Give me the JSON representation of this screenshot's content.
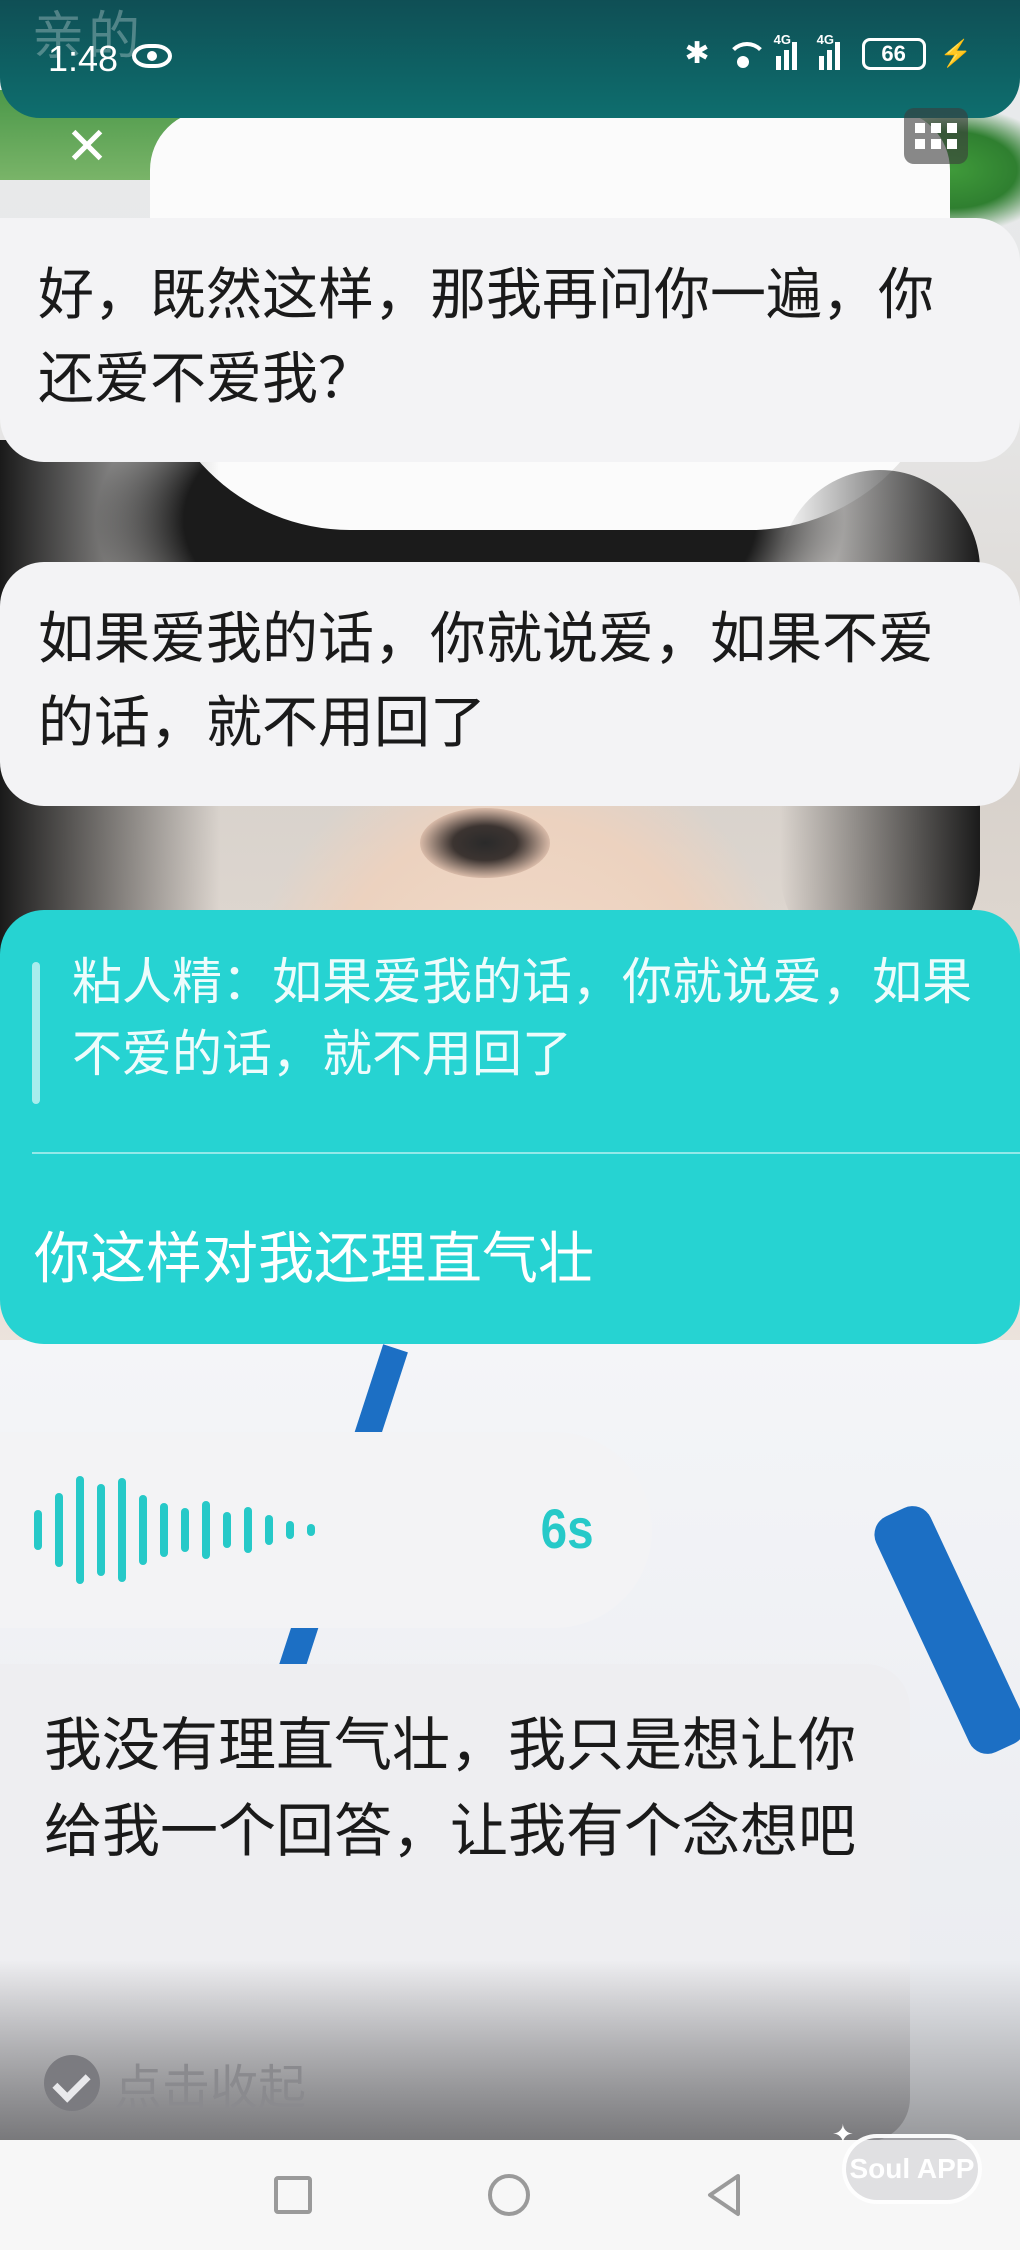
{
  "status_bar": {
    "faded_title": "亲的",
    "time": "1:48",
    "network_tag": "4G",
    "battery": "66"
  },
  "icons": {
    "close": "close-icon",
    "menu": "grid-menu-icon",
    "eye": "eye-icon",
    "bluetooth": "bluetooth-icon",
    "wifi": "wifi-icon",
    "collapse": "check-circle-icon"
  },
  "messages": {
    "msg1": "好，既然这样，那我再问你一遍，你还爱不爱我？",
    "msg2": "如果爱我的话，你就说爱，如果不爱的话，就不用回了",
    "reply_quote": "粘人精：如果爱我的话，你就说爱，如果不爱的话，就不用回了",
    "reply_text": "你这样对我还理直气壮",
    "voice_duration": "6s",
    "msg5": "我没有理直气壮，我只是想让你给我一个回答，让我有个念想吧"
  },
  "collapse_label": "点击收起",
  "watermark": "Soul APP",
  "colors": {
    "accent_teal": "#26d3d2",
    "status_bar": "#0e6e6e",
    "bubble_grey": "#f3f3f5"
  }
}
